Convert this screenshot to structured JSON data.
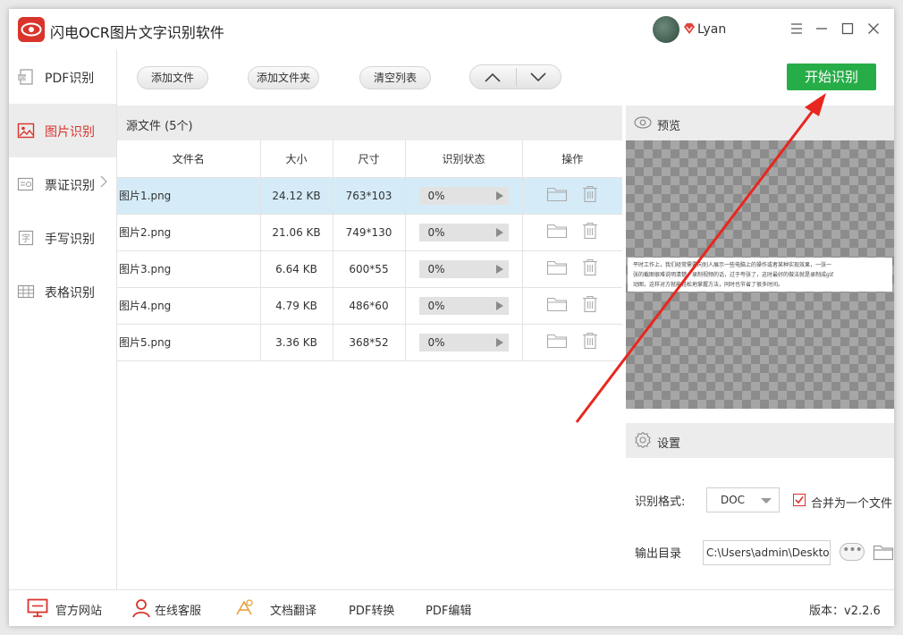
{
  "titlebar": {
    "title": "闪电OCR图片文字识别软件",
    "username": "Lyan",
    "brand_color": "#d9342b"
  },
  "sidebar": {
    "items": [
      {
        "label": "PDF识别",
        "icon": "pdf-icon",
        "active": false
      },
      {
        "label": "图片识别",
        "icon": "image-icon",
        "active": true
      },
      {
        "label": "票证识别",
        "icon": "ticket-icon",
        "active": false
      },
      {
        "label": "手写识别",
        "icon": "handwriting-icon",
        "active": false
      },
      {
        "label": "表格识别",
        "icon": "table-icon",
        "active": false
      }
    ]
  },
  "toolbar": {
    "add_file": "添加文件",
    "add_folder": "添加文件夹",
    "clear_list": "清空列表",
    "start": "开始识别",
    "start_color": "#27ad48"
  },
  "files": {
    "header": "源文件 (5个)",
    "columns": [
      "文件名",
      "大小",
      "尺寸",
      "识别状态",
      "操作"
    ],
    "rows": [
      {
        "name": "图片1.png",
        "size": "24.12 KB",
        "dim": "763*103",
        "status": "0%",
        "selected": true
      },
      {
        "name": "图片2.png",
        "size": "21.06 KB",
        "dim": "749*130",
        "status": "0%",
        "selected": false
      },
      {
        "name": "图片3.png",
        "size": "6.64 KB",
        "dim": "600*55",
        "status": "0%",
        "selected": false
      },
      {
        "name": "图片4.png",
        "size": "4.79 KB",
        "dim": "486*60",
        "status": "0%",
        "selected": false
      },
      {
        "name": "图片5.png",
        "size": "3.36 KB",
        "dim": "368*52",
        "status": "0%",
        "selected": false
      }
    ]
  },
  "preview": {
    "title": "预览",
    "text_lines": [
      "平时工作上，我们经常需要向别人展示一些电脑上的操作或者某种实现效果，一张一",
      "张的截图很难说明清楚，录制视频的话，过于夸张了，这时最好的做法就是录制成gif",
      "动图，这样对方就能轻松地掌握方法，同时也节省了很多时间。"
    ]
  },
  "settings": {
    "title": "设置",
    "format_label": "识别格式:",
    "format_value": "DOC",
    "merge_label": "合并为一个文件",
    "merge_checked": true,
    "output_label": "输出目录",
    "output_path": "C:\\Users\\admin\\Desktop",
    "browse_label": "•••"
  },
  "footer": {
    "website": "官方网站",
    "support": "在线客服",
    "translate": "文档翻译",
    "pdf_convert": "PDF转换",
    "pdf_edit": "PDF编辑",
    "version": "版本：v2.2.6"
  }
}
